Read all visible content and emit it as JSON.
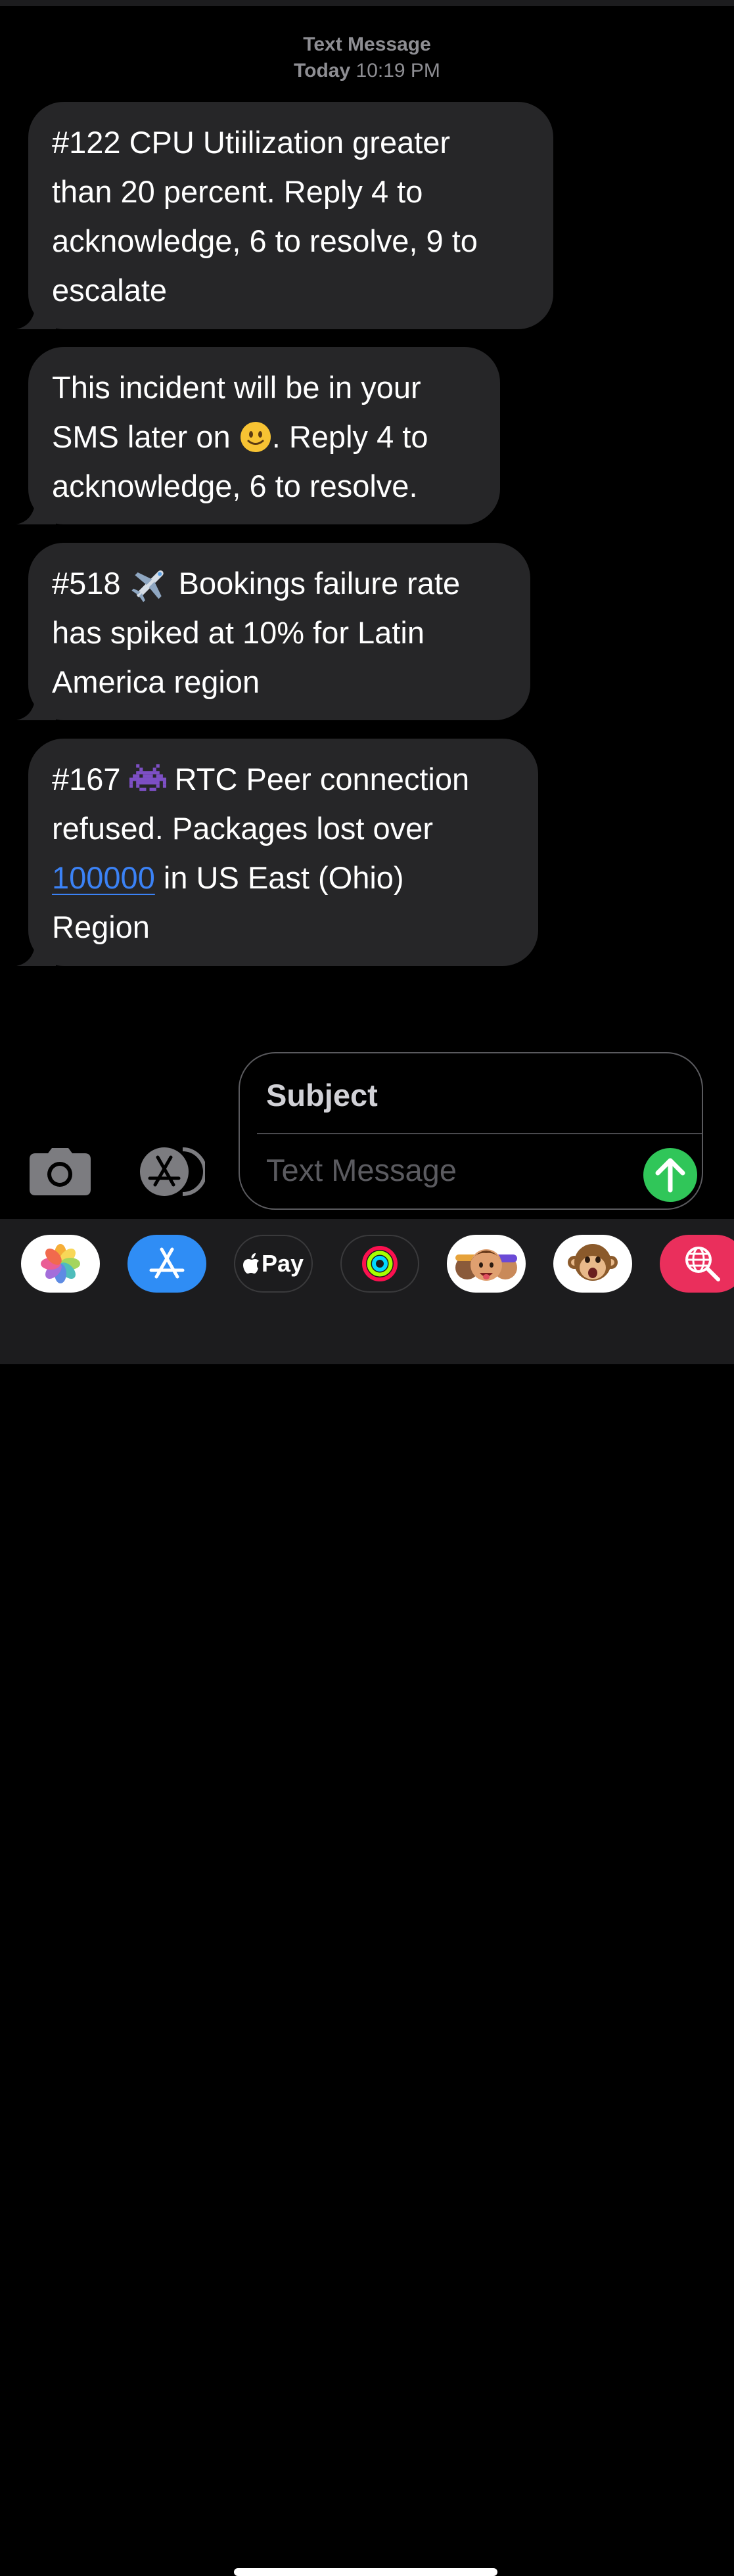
{
  "header": {
    "service": "Text Message",
    "day": "Today",
    "time": "10:19 PM"
  },
  "messages": [
    {
      "lines": [
        "#122 CPU Utiilization greater",
        "than 20 percent. Reply 4 to",
        "acknowledge, 6 to resolve, 9 to",
        "escalate"
      ]
    },
    {
      "line1": "This incident will be in your",
      "line2_before": "SMS later on ",
      "line2_after": ". Reply 4 to",
      "line3": "acknowledge, 6 to resolve.",
      "emoji": "slightly-smiling-face-icon"
    },
    {
      "line1_before": "#518 ",
      "line1_after": " Bookings failure rate",
      "line2": "has spiked at 10% for Latin",
      "line3": "America region",
      "emoji": "airplane-icon"
    },
    {
      "line1_before": "#167 ",
      "line1_after": " RTC Peer connection",
      "line2": "refused. Packages lost over",
      "line3_link": "100000",
      "line3_after": " in US East (Ohio)",
      "line4": "Region",
      "emoji": "alien-monster-icon"
    }
  ],
  "composer": {
    "subject_placeholder": "Subject",
    "message_placeholder": "Text Message",
    "send_color": "#30c659"
  },
  "toolbar": {
    "camera_icon": "camera-icon",
    "apps_icon": "app-store-icon"
  },
  "app_drawer": {
    "apps": [
      "photos-icon",
      "app-store-icon",
      "apple-pay-icon",
      "activity-icon",
      "memoji-icon",
      "animoji-monkey-icon",
      "web-search-icon"
    ],
    "apple_pay_label": "Pay"
  },
  "colors": {
    "bubble": "#262628",
    "link": "#3b82f6",
    "meta_text": "#8e8e93"
  }
}
